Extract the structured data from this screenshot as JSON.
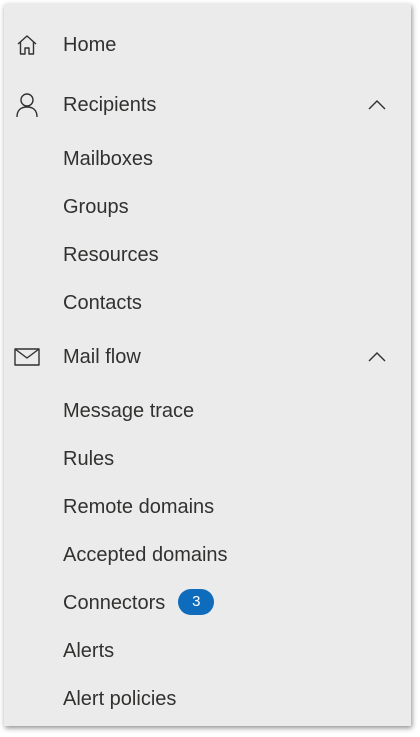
{
  "nav": {
    "home": {
      "label": "Home",
      "icon": "home-icon"
    },
    "recipients": {
      "label": "Recipients",
      "icon": "person-icon",
      "expanded": true,
      "items": [
        {
          "label": "Mailboxes"
        },
        {
          "label": "Groups"
        },
        {
          "label": "Resources"
        },
        {
          "label": "Contacts"
        }
      ]
    },
    "mail_flow": {
      "label": "Mail flow",
      "icon": "mail-icon",
      "expanded": true,
      "items": [
        {
          "label": "Message trace"
        },
        {
          "label": "Rules"
        },
        {
          "label": "Remote domains"
        },
        {
          "label": "Accepted domains"
        },
        {
          "label": "Connectors",
          "badge": "3"
        },
        {
          "label": "Alerts"
        },
        {
          "label": "Alert policies"
        }
      ]
    }
  },
  "colors": {
    "panel_bg": "#ebebeb",
    "text": "#323130",
    "badge_bg": "#0f6cbd",
    "badge_text": "#ffffff"
  }
}
